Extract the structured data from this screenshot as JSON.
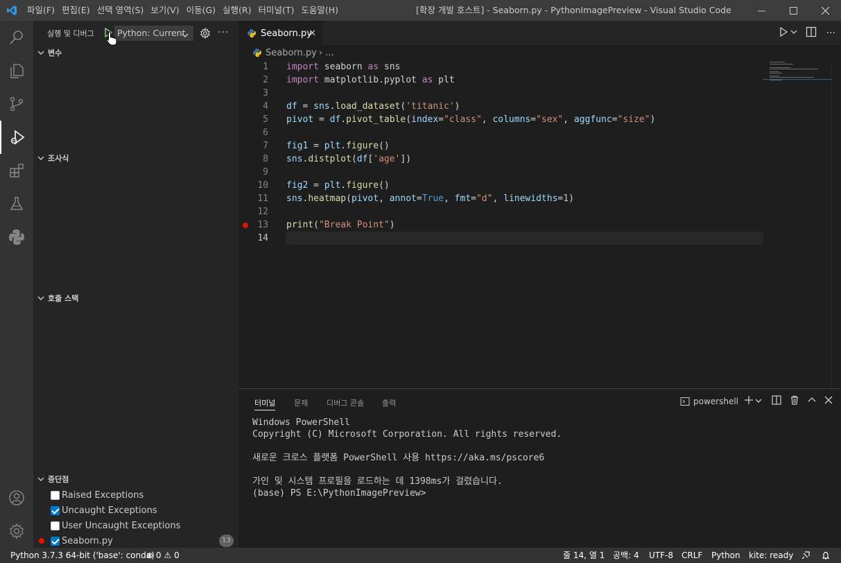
{
  "titlebar": {
    "menu": [
      "파일(F)",
      "편집(E)",
      "선택 영역(S)",
      "보기(V)",
      "이동(G)",
      "실행(R)",
      "터미널(T)",
      "도움말(H)"
    ],
    "title": "[확장 개발 호스트] - Seaborn.py - PythonImagePreview - Visual Studio Code"
  },
  "sidebar": {
    "title": "실행 및 디버그",
    "config": "Python: Current",
    "sections": {
      "variables": "변수",
      "watch": "조사식",
      "callstack": "호출 스택",
      "breakpoints": "중단점"
    },
    "breakpoints": [
      {
        "label": "Raised Exceptions",
        "checked": false
      },
      {
        "label": "Uncaught Exceptions",
        "checked": true
      },
      {
        "label": "User Uncaught Exceptions",
        "checked": false
      },
      {
        "label": "Seaborn.py",
        "checked": true,
        "count": "13"
      }
    ]
  },
  "editor": {
    "tab": "Seaborn.py",
    "breadcrumb": {
      "file": "Seaborn.py",
      "rest": "..."
    },
    "line_numbers": [
      "1",
      "2",
      "3",
      "4",
      "5",
      "6",
      "7",
      "8",
      "9",
      "10",
      "11",
      "12",
      "13",
      "14"
    ],
    "lines": {
      "l1": {
        "a": "import",
        "b": " seaborn ",
        "c": "as",
        "d": " sns"
      },
      "l2": {
        "a": "import",
        "b": " matplotlib.pyplot ",
        "c": "as",
        "d": " plt"
      },
      "l4": {
        "a": "df",
        "b": " = ",
        "c": "sns",
        "d": ".",
        "e": "load_dataset",
        "f": "(",
        "g": "'titanic'",
        "h": ")"
      },
      "l5": {
        "a": "pivot",
        "b": " = ",
        "c": "df",
        "d": ".",
        "e": "pivot_table",
        "f": "(",
        "g": "index",
        "h": "=",
        "i": "\"class\"",
        "j": ", ",
        "k": "columns",
        "l": "=",
        "m": "\"sex\"",
        "n": ", ",
        "o": "aggfunc",
        "p": "=",
        "q": "\"size\"",
        "r": ")"
      },
      "l7": {
        "a": "fig1",
        "b": " = ",
        "c": "plt",
        "d": ".",
        "e": "figure",
        "f": "()"
      },
      "l8": {
        "a": "sns",
        "b": ".",
        "c": "distplot",
        "d": "(",
        "e": "df",
        "f": "[",
        "g": "'age'",
        "h": "])"
      },
      "l10": {
        "a": "fig2",
        "b": " = ",
        "c": "plt",
        "d": ".",
        "e": "figure",
        "f": "()"
      },
      "l11": {
        "a": "sns",
        "b": ".",
        "c": "heatmap",
        "d": "(",
        "e": "pivot",
        "f": ", ",
        "g": "annot",
        "h": "=",
        "i": "True",
        "j": ", ",
        "k": "fmt",
        "l": "=",
        "m": "\"d\"",
        "n": ", ",
        "o": "linewidths",
        "p": "=",
        "q": "1",
        "r": ")"
      },
      "l13": {
        "a": "print",
        "b": "(",
        "c": "\"Break Point\"",
        "d": ")"
      }
    }
  },
  "panel": {
    "tabs": [
      "터미널",
      "문제",
      "디버그 콘솔",
      "출력"
    ],
    "shell": "powershell",
    "terminal": [
      "Windows PowerShell",
      "Copyright (C) Microsoft Corporation. All rights reserved.",
      "",
      "새로운 크로스 플랫폼 PowerShell 사용 https://aka.ms/pscore6",
      "",
      "가인 및 시스템 프로필을 로드하는 데 1398ms가 걸렸습니다.",
      "(base) PS E:\\PythonImagePreview>"
    ]
  },
  "statusbar": {
    "interpreter": "Python 3.7.3 64-bit ('base': conda)",
    "errors": "0",
    "warnings": "0",
    "position": "줄 14, 열 1",
    "spaces": "공백: 4",
    "encoding": "UTF-8",
    "eol": "CRLF",
    "language": "Python",
    "kite": "kite: ready"
  },
  "colors": {
    "accent": "#007acc",
    "breakpoint": "#e51400"
  }
}
